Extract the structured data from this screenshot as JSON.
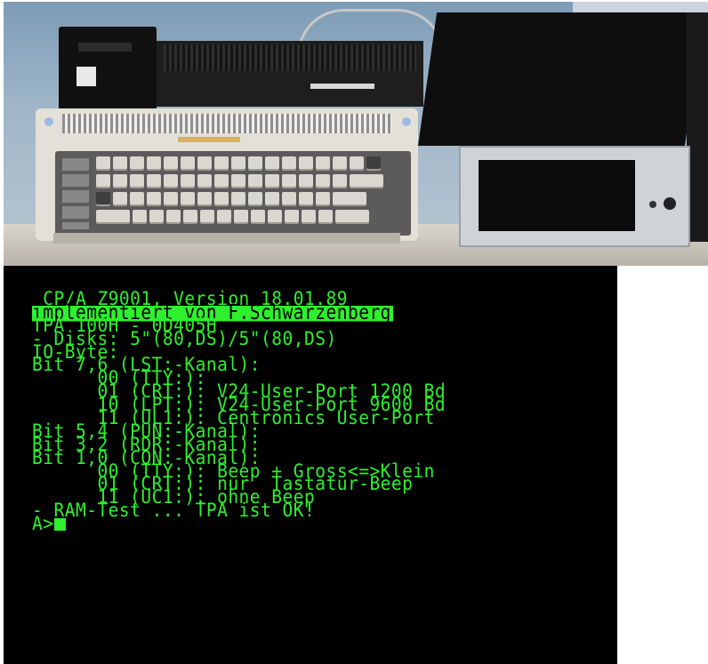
{
  "screen": {
    "lines": [
      " CP/A Z9001, Version 18.01.89",
      "implementiert von F.Schwarzenberg",
      "TPA 100H - 0D405H",
      "- Disks: 5\"(80,DS)/5\"(80,DS)",
      "IO-Byte:",
      "Bit 7,6 (LST:-Kanal):",
      "      00 (TTY:):",
      "      01 (CRT:): V24-User-Port 1200 Bd",
      "      10 (LPT:): V24-User-Port 9600 Bd",
      "      11 (UL1:): Centronics User-Port",
      "Bit 5,4 (PUN:-Kanal):",
      "Bit 3,2 (RDR:-Kanal):",
      "Bit 1,0 (CON:-Kanal):",
      "      00 (TTY:): Beep + Gross<=>Klein",
      "      01 (CRT:): nur  Tastatur-Beep",
      "      11 (UC1:): ohne Beep",
      "- RAM-Test ... TPA ist OK!"
    ],
    "prompt": "A>",
    "colors": {
      "text": "#2ef02e",
      "background": "#000000"
    }
  },
  "photo": {
    "icons": [
      "printer-icon",
      "keyboard-icon",
      "disk-drive-box-icon"
    ]
  }
}
